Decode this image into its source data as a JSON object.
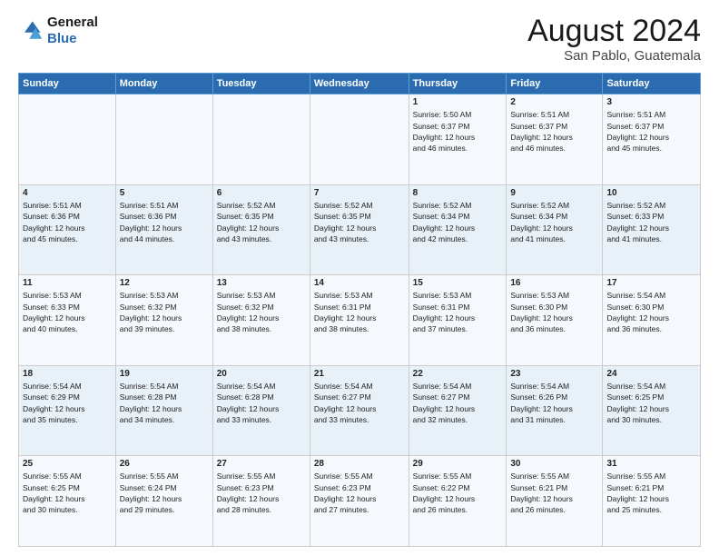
{
  "header": {
    "logo_line1": "General",
    "logo_line2": "Blue",
    "month_title": "August 2024",
    "location": "San Pablo, Guatemala"
  },
  "days_of_week": [
    "Sunday",
    "Monday",
    "Tuesday",
    "Wednesday",
    "Thursday",
    "Friday",
    "Saturday"
  ],
  "weeks": [
    [
      {
        "day": "",
        "content": ""
      },
      {
        "day": "",
        "content": ""
      },
      {
        "day": "",
        "content": ""
      },
      {
        "day": "",
        "content": ""
      },
      {
        "day": "1",
        "content": "Sunrise: 5:50 AM\nSunset: 6:37 PM\nDaylight: 12 hours\nand 46 minutes."
      },
      {
        "day": "2",
        "content": "Sunrise: 5:51 AM\nSunset: 6:37 PM\nDaylight: 12 hours\nand 46 minutes."
      },
      {
        "day": "3",
        "content": "Sunrise: 5:51 AM\nSunset: 6:37 PM\nDaylight: 12 hours\nand 45 minutes."
      }
    ],
    [
      {
        "day": "4",
        "content": "Sunrise: 5:51 AM\nSunset: 6:36 PM\nDaylight: 12 hours\nand 45 minutes."
      },
      {
        "day": "5",
        "content": "Sunrise: 5:51 AM\nSunset: 6:36 PM\nDaylight: 12 hours\nand 44 minutes."
      },
      {
        "day": "6",
        "content": "Sunrise: 5:52 AM\nSunset: 6:35 PM\nDaylight: 12 hours\nand 43 minutes."
      },
      {
        "day": "7",
        "content": "Sunrise: 5:52 AM\nSunset: 6:35 PM\nDaylight: 12 hours\nand 43 minutes."
      },
      {
        "day": "8",
        "content": "Sunrise: 5:52 AM\nSunset: 6:34 PM\nDaylight: 12 hours\nand 42 minutes."
      },
      {
        "day": "9",
        "content": "Sunrise: 5:52 AM\nSunset: 6:34 PM\nDaylight: 12 hours\nand 41 minutes."
      },
      {
        "day": "10",
        "content": "Sunrise: 5:52 AM\nSunset: 6:33 PM\nDaylight: 12 hours\nand 41 minutes."
      }
    ],
    [
      {
        "day": "11",
        "content": "Sunrise: 5:53 AM\nSunset: 6:33 PM\nDaylight: 12 hours\nand 40 minutes."
      },
      {
        "day": "12",
        "content": "Sunrise: 5:53 AM\nSunset: 6:32 PM\nDaylight: 12 hours\nand 39 minutes."
      },
      {
        "day": "13",
        "content": "Sunrise: 5:53 AM\nSunset: 6:32 PM\nDaylight: 12 hours\nand 38 minutes."
      },
      {
        "day": "14",
        "content": "Sunrise: 5:53 AM\nSunset: 6:31 PM\nDaylight: 12 hours\nand 38 minutes."
      },
      {
        "day": "15",
        "content": "Sunrise: 5:53 AM\nSunset: 6:31 PM\nDaylight: 12 hours\nand 37 minutes."
      },
      {
        "day": "16",
        "content": "Sunrise: 5:53 AM\nSunset: 6:30 PM\nDaylight: 12 hours\nand 36 minutes."
      },
      {
        "day": "17",
        "content": "Sunrise: 5:54 AM\nSunset: 6:30 PM\nDaylight: 12 hours\nand 36 minutes."
      }
    ],
    [
      {
        "day": "18",
        "content": "Sunrise: 5:54 AM\nSunset: 6:29 PM\nDaylight: 12 hours\nand 35 minutes."
      },
      {
        "day": "19",
        "content": "Sunrise: 5:54 AM\nSunset: 6:28 PM\nDaylight: 12 hours\nand 34 minutes."
      },
      {
        "day": "20",
        "content": "Sunrise: 5:54 AM\nSunset: 6:28 PM\nDaylight: 12 hours\nand 33 minutes."
      },
      {
        "day": "21",
        "content": "Sunrise: 5:54 AM\nSunset: 6:27 PM\nDaylight: 12 hours\nand 33 minutes."
      },
      {
        "day": "22",
        "content": "Sunrise: 5:54 AM\nSunset: 6:27 PM\nDaylight: 12 hours\nand 32 minutes."
      },
      {
        "day": "23",
        "content": "Sunrise: 5:54 AM\nSunset: 6:26 PM\nDaylight: 12 hours\nand 31 minutes."
      },
      {
        "day": "24",
        "content": "Sunrise: 5:54 AM\nSunset: 6:25 PM\nDaylight: 12 hours\nand 30 minutes."
      }
    ],
    [
      {
        "day": "25",
        "content": "Sunrise: 5:55 AM\nSunset: 6:25 PM\nDaylight: 12 hours\nand 30 minutes."
      },
      {
        "day": "26",
        "content": "Sunrise: 5:55 AM\nSunset: 6:24 PM\nDaylight: 12 hours\nand 29 minutes."
      },
      {
        "day": "27",
        "content": "Sunrise: 5:55 AM\nSunset: 6:23 PM\nDaylight: 12 hours\nand 28 minutes."
      },
      {
        "day": "28",
        "content": "Sunrise: 5:55 AM\nSunset: 6:23 PM\nDaylight: 12 hours\nand 27 minutes."
      },
      {
        "day": "29",
        "content": "Sunrise: 5:55 AM\nSunset: 6:22 PM\nDaylight: 12 hours\nand 26 minutes."
      },
      {
        "day": "30",
        "content": "Sunrise: 5:55 AM\nSunset: 6:21 PM\nDaylight: 12 hours\nand 26 minutes."
      },
      {
        "day": "31",
        "content": "Sunrise: 5:55 AM\nSunset: 6:21 PM\nDaylight: 12 hours\nand 25 minutes."
      }
    ]
  ]
}
